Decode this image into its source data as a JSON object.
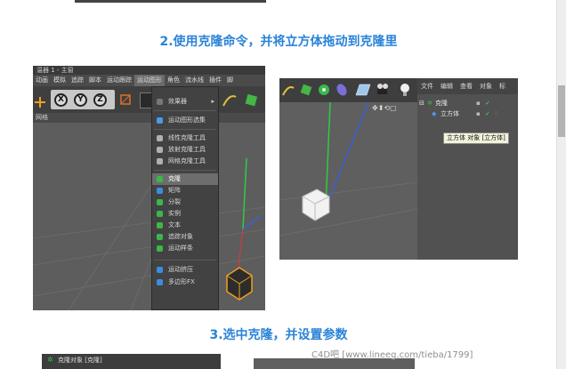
{
  "headings": {
    "step2": "2.使用克隆命令，并将立方体拖动到克隆里",
    "step3": "3.选中克隆，并设置参数"
  },
  "left_screenshot": {
    "title_fragment": "温器 1 - 主窗",
    "menubar": [
      "动画",
      "模拟",
      "追踪",
      "脚本",
      "运动跟踪",
      "运动图形",
      "角色",
      "流水线",
      "插件",
      "脚"
    ],
    "active_menu": "运动图形",
    "axis_buttons": [
      "X",
      "Y",
      "Z"
    ],
    "view_header": "网格",
    "menu_items": [
      {
        "label": "效果器",
        "icon": "gray",
        "submenu": true
      },
      {
        "label": "运动图形选集",
        "icon": "#4a9be8"
      },
      {
        "label": "线性克隆工具",
        "icon": "#b0b0b0"
      },
      {
        "label": "放射克隆工具",
        "icon": "#b0b0b0"
      },
      {
        "label": "网格克隆工具",
        "icon": "#b0b0b0"
      },
      {
        "label": "克隆",
        "icon": "#3ab84a",
        "highlight": true
      },
      {
        "label": "矩阵",
        "icon": "#3a8de0"
      },
      {
        "label": "分裂",
        "icon": "#3ab84a"
      },
      {
        "label": "实例",
        "icon": "#3ab84a"
      },
      {
        "label": "文本",
        "icon": "#3ab84a"
      },
      {
        "label": "追踪对象",
        "icon": "#3ab84a"
      },
      {
        "label": "运动样条",
        "icon": "#3ab84a"
      },
      {
        "label": "运动挤压",
        "icon": "#3a8de0"
      },
      {
        "label": "多边形FX",
        "icon": "#3a8de0"
      }
    ]
  },
  "right_screenshot": {
    "panel_menu": [
      "文件",
      "编辑",
      "查看",
      "对象",
      "标"
    ],
    "objects": [
      {
        "name": "克隆",
        "indent": 0
      },
      {
        "name": "立方体",
        "indent": 1
      }
    ],
    "tooltip": "立方体 对象 [立方体]"
  },
  "bottom_screenshot": {
    "title": "克隆对象 [克隆]"
  },
  "watermark": "C4D吧 [www.lineeg.com/tieba/1799]",
  "colors": {
    "heading": "#2a83d8",
    "menu_bg": "#424242",
    "menu_highlight": "#6d6d6d",
    "viewport": "#5d5d5d",
    "axis_y": "#2ecc40",
    "axis_x": "#d93a3a",
    "axis_z": "#3a5fd9"
  }
}
